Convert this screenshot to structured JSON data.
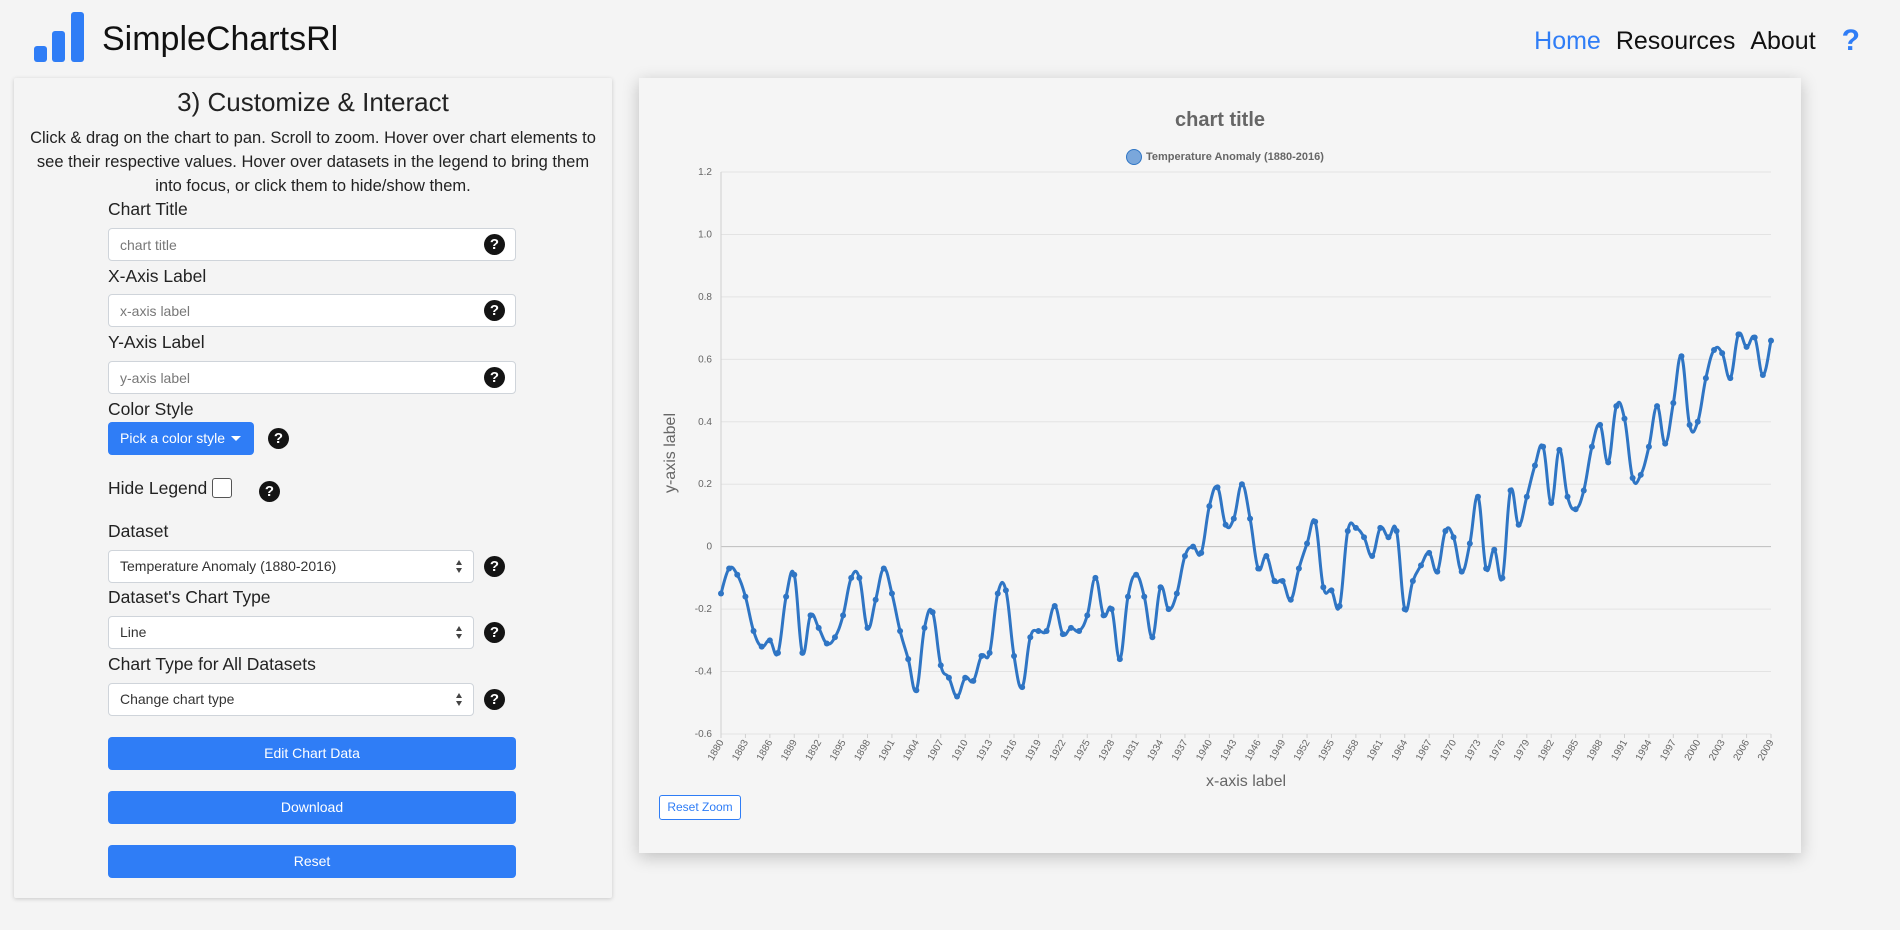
{
  "navbar": {
    "brand": "SimpleChartsRl",
    "links": [
      "Home",
      "Resources",
      "About"
    ],
    "help": "?"
  },
  "panel": {
    "title": "3) Customize & Interact",
    "description": "Click & drag on the chart to pan. Scroll to zoom. Hover over chart elements to see their respective values. Hover over datasets in the legend to bring them into focus, or click them to hide/show them.",
    "chart_title_label": "Chart Title",
    "chart_title_placeholder": "chart title",
    "x_axis_label": "X-Axis Label",
    "x_axis_placeholder": "x-axis label",
    "y_axis_label": "Y-Axis Label",
    "y_axis_placeholder": "y-axis label",
    "color_style_label": "Color Style",
    "color_style_button": "Pick a color style",
    "hide_legend_label": "Hide Legend",
    "dataset_label": "Dataset",
    "dataset_value": "Temperature Anomaly (1880-2016)",
    "chart_type_label": "Dataset's Chart Type",
    "chart_type_value": "Line",
    "all_chart_type_label": "Chart Type for All Datasets",
    "all_chart_type_value": "Change chart type",
    "edit_button": "Edit Chart Data",
    "download_button": "Download",
    "reset_button": "Reset",
    "help_glyph": "?"
  },
  "chart": {
    "reset_zoom": "Reset Zoom"
  },
  "colors": {
    "accent": "#2f7df6",
    "line": "#2f75c4",
    "dark": "#141414"
  },
  "chart_data": {
    "type": "line",
    "title": "chart title",
    "xlabel": "x-axis label",
    "ylabel": "y-axis label",
    "legend": "top-center",
    "grid": true,
    "ylim": [
      -0.6,
      1.2
    ],
    "yticks": [
      "-0.6",
      "-0.4",
      "-0.2",
      "0",
      "0.2",
      "0.4",
      "0.6",
      "0.8",
      "1.0",
      "1.2"
    ],
    "xticks": [
      "1880",
      "1883",
      "1886",
      "1889",
      "1892",
      "1895",
      "1898",
      "1901",
      "1904",
      "1907",
      "1910",
      "1913",
      "1916",
      "1919",
      "1922",
      "1925",
      "1928",
      "1931",
      "1934",
      "1937",
      "1940",
      "1943",
      "1946",
      "1949",
      "1952",
      "1955",
      "1958",
      "1961",
      "1964",
      "1967",
      "1970",
      "1973",
      "1976",
      "1979",
      "1982",
      "1985",
      "1988",
      "1991",
      "1994",
      "1997",
      "2000",
      "2003",
      "2006",
      "2009"
    ],
    "x_start": 1880,
    "series": [
      {
        "name": "Temperature Anomaly (1880-2016)",
        "values": [
          -0.15,
          -0.07,
          -0.09,
          -0.16,
          -0.27,
          -0.32,
          -0.3,
          -0.34,
          -0.16,
          -0.09,
          -0.34,
          -0.22,
          -0.26,
          -0.31,
          -0.29,
          -0.22,
          -0.1,
          -0.1,
          -0.26,
          -0.17,
          -0.07,
          -0.15,
          -0.27,
          -0.36,
          -0.46,
          -0.26,
          -0.21,
          -0.38,
          -0.42,
          -0.48,
          -0.42,
          -0.43,
          -0.35,
          -0.34,
          -0.15,
          -0.14,
          -0.35,
          -0.45,
          -0.29,
          -0.27,
          -0.27,
          -0.19,
          -0.28,
          -0.26,
          -0.27,
          -0.22,
          -0.1,
          -0.22,
          -0.2,
          -0.36,
          -0.16,
          -0.09,
          -0.16,
          -0.29,
          -0.13,
          -0.2,
          -0.15,
          -0.03,
          0.0,
          -0.02,
          0.13,
          0.19,
          0.07,
          0.09,
          0.2,
          0.09,
          -0.07,
          -0.03,
          -0.11,
          -0.11,
          -0.17,
          -0.07,
          0.01,
          0.08,
          -0.13,
          -0.14,
          -0.19,
          0.05,
          0.06,
          0.03,
          -0.03,
          0.06,
          0.03,
          0.05,
          -0.2,
          -0.11,
          -0.06,
          -0.02,
          -0.08,
          0.05,
          0.03,
          -0.08,
          0.01,
          0.16,
          -0.07,
          -0.01,
          -0.1,
          0.18,
          0.07,
          0.16,
          0.26,
          0.32,
          0.14,
          0.31,
          0.16,
          0.12,
          0.18,
          0.32,
          0.39,
          0.27,
          0.45,
          0.41,
          0.22,
          0.23,
          0.32,
          0.45,
          0.33,
          0.46,
          0.61,
          0.39,
          0.4,
          0.54,
          0.63,
          0.62,
          0.54,
          0.68,
          0.64,
          0.67,
          0.55,
          0.66
        ]
      }
    ]
  }
}
